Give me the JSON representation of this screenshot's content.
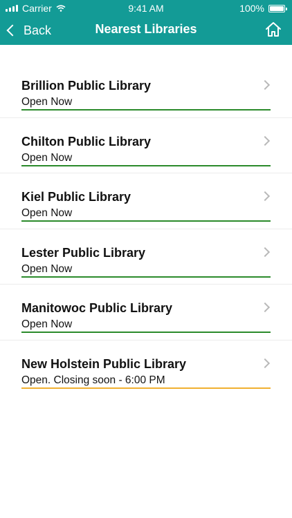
{
  "status_bar": {
    "carrier": "Carrier",
    "time": "9:41 AM",
    "battery": "100%"
  },
  "nav": {
    "back_label": "Back",
    "title": "Nearest Libraries"
  },
  "libraries": [
    {
      "name": "Brillion Public Library",
      "status": "Open Now",
      "status_color": "#2a8a2a"
    },
    {
      "name": "Chilton Public Library",
      "status": "Open Now",
      "status_color": "#2a8a2a"
    },
    {
      "name": "Kiel Public Library",
      "status": "Open Now",
      "status_color": "#2a8a2a"
    },
    {
      "name": "Lester Public Library",
      "status": "Open Now",
      "status_color": "#2a8a2a"
    },
    {
      "name": "Manitowoc Public Library",
      "status": "Open Now",
      "status_color": "#2a8a2a"
    },
    {
      "name": "New Holstein Public Library",
      "status": "Open. Closing soon - 6:00 PM",
      "status_color": "#f0b030"
    }
  ],
  "colors": {
    "header_bg": "#139b96",
    "open_bar": "#2a8a2a",
    "closing_soon_bar": "#f0b030"
  }
}
